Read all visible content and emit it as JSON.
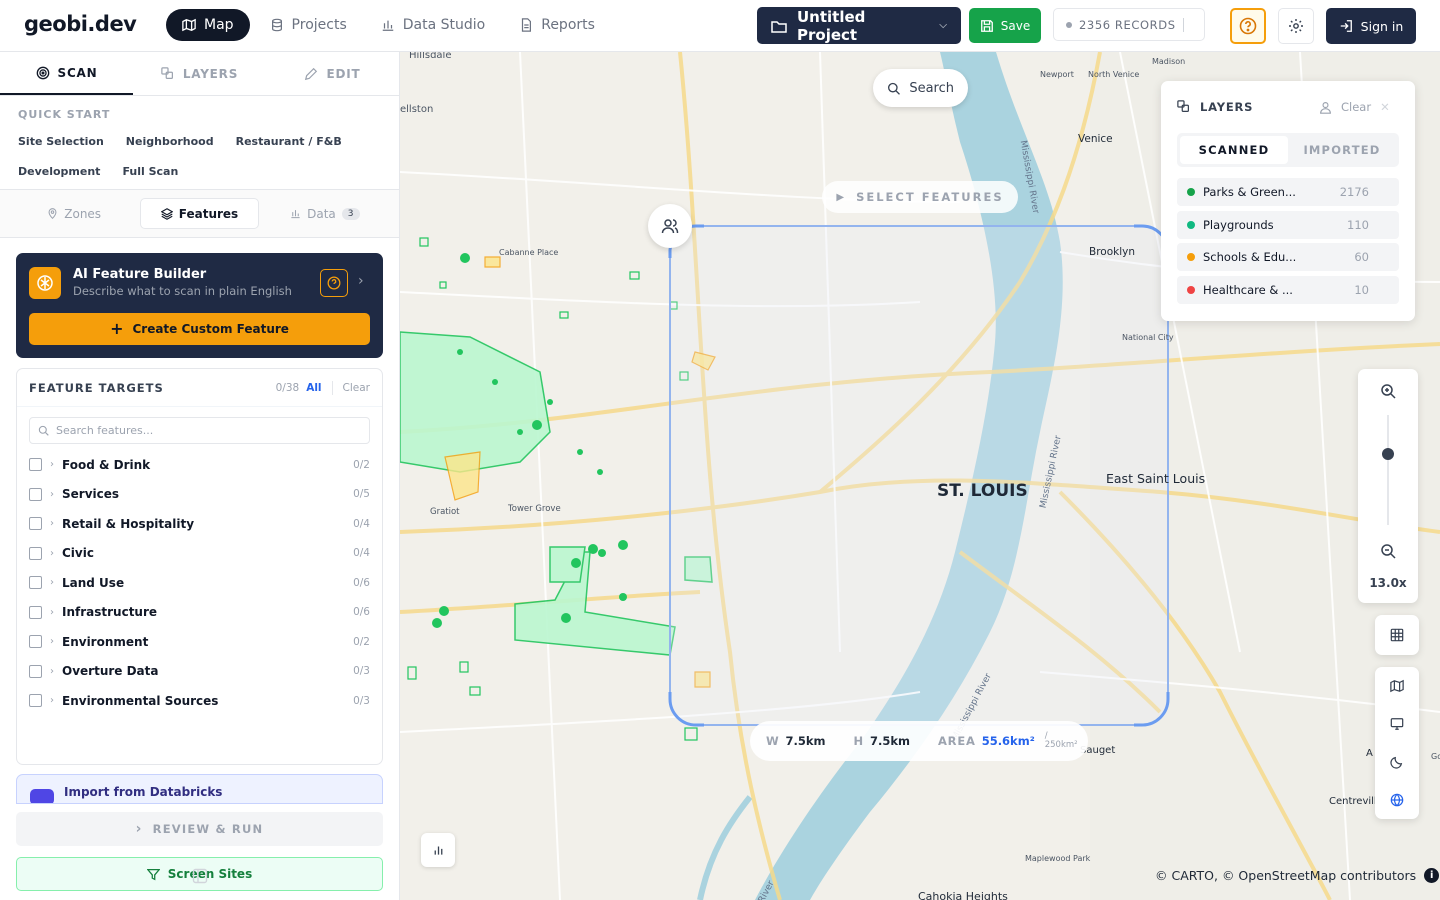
{
  "app": {
    "logo": "geobi.dev"
  },
  "nav": {
    "items": [
      {
        "label": "Map",
        "icon": "map-icon",
        "active": true
      },
      {
        "label": "Projects",
        "icon": "database-icon",
        "active": false
      },
      {
        "label": "Data Studio",
        "icon": "bar-chart-icon",
        "active": false
      },
      {
        "label": "Reports",
        "icon": "document-icon",
        "active": false
      }
    ]
  },
  "header": {
    "project_name": "Untitled Project",
    "save_label": "Save",
    "records": "2356 RECORDS",
    "signin_label": "Sign in"
  },
  "sidebar": {
    "tabs": [
      {
        "label": "SCAN",
        "icon": "scan-icon",
        "active": true
      },
      {
        "label": "LAYERS",
        "icon": "layers-icon",
        "active": false
      },
      {
        "label": "EDIT",
        "icon": "pencil-icon",
        "active": false
      }
    ],
    "quick_start": {
      "title": "QUICK START",
      "chips": [
        "Site Selection",
        "Neighborhood",
        "Restaurant / F&B",
        "Development",
        "Full Scan"
      ]
    },
    "subtabs": [
      {
        "label": "Zones",
        "icon": "pin-icon",
        "active": false
      },
      {
        "label": "Features",
        "icon": "stack-icon",
        "active": true
      },
      {
        "label": "Data",
        "icon": "bar-chart-icon",
        "active": false,
        "badge": "3"
      }
    ],
    "ai_builder": {
      "title": "AI Feature Builder",
      "subtitle": "Describe what to scan in plain English",
      "create_label": "Create Custom Feature"
    },
    "feature_targets": {
      "title": "FEATURE TARGETS",
      "count": "0/38",
      "all_label": "All",
      "clear_label": "Clear",
      "search_placeholder": "Search features...",
      "items": [
        {
          "name": "Food & Drink",
          "count": "0/2"
        },
        {
          "name": "Services",
          "count": "0/5"
        },
        {
          "name": "Retail & Hospitality",
          "count": "0/4"
        },
        {
          "name": "Civic",
          "count": "0/4"
        },
        {
          "name": "Land Use",
          "count": "0/6"
        },
        {
          "name": "Infrastructure",
          "count": "0/6"
        },
        {
          "name": "Environment",
          "count": "0/2"
        },
        {
          "name": "Overture Data",
          "count": "0/3"
        },
        {
          "name": "Environmental Sources",
          "count": "0/3"
        }
      ]
    },
    "import_label": "Import from Databricks",
    "review_label": "REVIEW & RUN",
    "screen_label": "Screen Sites"
  },
  "map": {
    "search_label": "Search",
    "select_features_label": "SELECT FEATURES",
    "labels": {
      "city": "ST. LOUIS",
      "east_st_louis": "East Saint Louis",
      "brooklyn": "Brooklyn",
      "venice": "Venice",
      "madison": "Madison",
      "newport": "Newport",
      "north_venice": "North Venice",
      "national_city": "National City",
      "hillsdale": "Hillsdale",
      "ellston": "ellston",
      "cabanne": "Cabanne Place",
      "gratiot": "Gratiot",
      "tower_grove": "Tower Grove",
      "sauget": "Sauget",
      "centreville": "Centrevill",
      "maplewood": "Maplewood Park",
      "cahokia": "Cahokia Heights",
      "a_label": "A",
      "go_label": "Go",
      "river1": "Mississippi River",
      "river2": "Mississippi River",
      "river3": "Mississippi River",
      "river4": "River"
    },
    "selection": {
      "w_label": "W",
      "w_value": "7.5km",
      "h_label": "H",
      "h_value": "7.5km",
      "area_label": "AREA",
      "area_value": "55.6km²",
      "area_limit": "/",
      "area_limit_value": "250km²"
    },
    "zoom": {
      "level": "13.0x",
      "slider_fraction": 0.35
    },
    "attribution": "© CARTO, © OpenStreetMap contributors",
    "info_glyph": "i"
  },
  "layers_panel": {
    "title": "LAYERS",
    "clear_label": "Clear",
    "tabs": [
      {
        "label": "SCANNED",
        "active": true
      },
      {
        "label": "IMPORTED",
        "active": false
      }
    ],
    "rows": [
      {
        "name": "Parks & Green...",
        "count": "2176",
        "color": "#16a34a"
      },
      {
        "name": "Playgrounds",
        "count": "110",
        "color": "#10b981"
      },
      {
        "name": "Schools & Edu...",
        "count": "60",
        "color": "#f59e0b"
      },
      {
        "name": "Healthcare & ...",
        "count": "10",
        "color": "#ef4444"
      }
    ]
  },
  "colors": {
    "accent": "#f59e0b",
    "primary": "#1f2a44",
    "success": "#16a34a",
    "selection": "#6b9cf0",
    "river": "#aad3df",
    "feature_green": "#22c55e"
  }
}
